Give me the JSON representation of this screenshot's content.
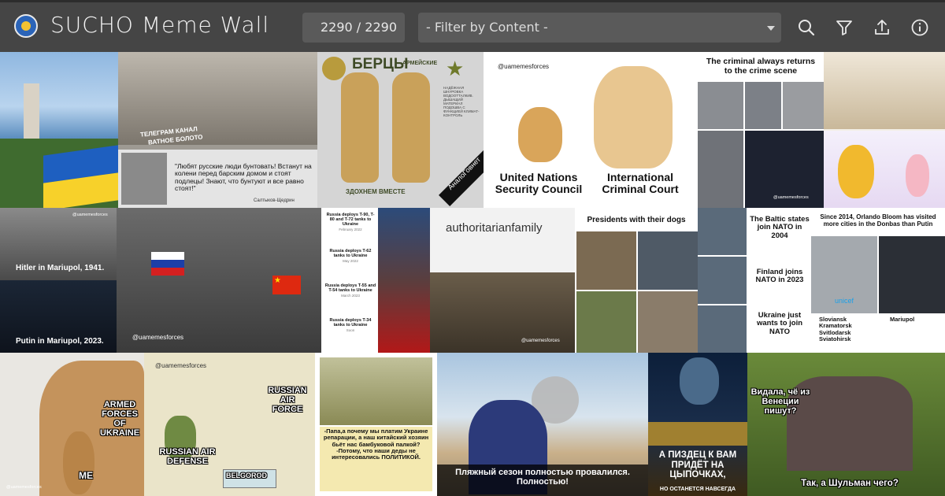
{
  "app": {
    "title": "SUCHO Meme Wall",
    "counter": "2290 / 2290",
    "filter_placeholder": "- Filter by Content -"
  },
  "toolbar": {
    "icons": [
      "search-icon",
      "filter-icon",
      "upload-icon",
      "info-icon"
    ]
  },
  "memes": {
    "m2_caption_a": "ТЕЛЕГРАМ КАНАЛ",
    "m2_caption_b": "ВАТНОЕ БОЛОТО",
    "m2_quote": "\"Любят русские люди бунтовать! Встанут на колени перед барским домом и стоят подлецы! Знают, что бунтуют и все равно стоят!\"",
    "m2_author": "Салтыков-Щедрин",
    "m3_title": "БЕРЦЫ",
    "m3_subtitle": "АРМЕЙСКИЕ",
    "m3_side": "НАДЁЖНАЯ ШНУРОВКА ВОДООТТАЛКИВ. ДЫШАЩИЙ МАТЕРИАЛ ПОДОШВА С ФУНКЦИЕЙ КЛИМАТ-КОНТРОЛЬ",
    "m3_bottom": "ЗДОХНЕМ ВМЕСТЕ",
    "m3_ribbon": "АналоГовнет",
    "m4_handle": "@uamemesforces",
    "m4_left": "United Nations Security Council",
    "m4_right": "International Criminal Court",
    "m5_title": "The criminal always returns to the crime scene",
    "m5_handle": "@uamemesforces",
    "m7_top": "Hitler in Mariupol, 1941.",
    "m7_bottom": "Putin in Mariupol, 2023.",
    "m7_handle": "@uamemesforces",
    "m8_handle": "@uamemesforces",
    "m9_rows": [
      {
        "text": "Russia deploys T-90, T-80 and T-72 tanks to Ukraine",
        "date": "February 2022"
      },
      {
        "text": "Russia deploys T-62 tanks to Ukraine",
        "date": "May 2022"
      },
      {
        "text": "Russia deploys T-55 and T-54 tanks to Ukraine",
        "date": "March 2023"
      },
      {
        "text": "Russia deploys T-34 tanks to Ukraine",
        "date": "Soon"
      }
    ],
    "m10_title": "authoritarianfamily",
    "m10_handle": "@uamemesforces",
    "m11_title": "Presidents with their dogs",
    "m12_rows": [
      "The Baltic states join NATO in 2004",
      "Finland joins NATO in 2023",
      "Ukraine just wants to join NATO"
    ],
    "m13_title": "Since 2014, Orlando Bloom has visited more cities in the Donbas than Putin",
    "m13_left": [
      "Sloviansk",
      "Kramatorsk",
      "Svitlodarsk",
      "Sviatohirsk"
    ],
    "m13_right": [
      "Mariupol"
    ],
    "m13_badge": "unicef",
    "m14_main": "ARMED FORCES OF UKRAINE",
    "m14_small": "ME",
    "m14_handle": "@uamemesforces",
    "m15_handle": "@uamemesforces",
    "m15_top": "RUSSIAN AIR FORCE",
    "m15_mid": "RUSSIAN AIR DEFENSE",
    "m15_bottom": "BELGOROD",
    "m16_text": "-Папа,а почему мы платим Украине репарации, а наш китайский хозяин бьёт нас бамбуковой палкой? -Потому, что наши деды не интересовались ПОЛИТИКОЙ.",
    "m17_text": "Пляжный сезон полностью провалился. Полностью!",
    "m18_top": "А ПИЗДЕЦ К ВАМ ПРИДЁТ НА ЦЫПОЧКАХ,",
    "m18_bottom": "НО ОСТАНЕТСЯ НАВСЕГДА",
    "m19_top": "Видала, чё из Венеции пишут?",
    "m19_bottom": "Так, а Шульман чего?"
  },
  "colors": {
    "topbar": "#454545",
    "control": "#5a5a5a",
    "ukraine_blue": "#1e5fc0",
    "ukraine_yellow": "#f7d12a"
  }
}
